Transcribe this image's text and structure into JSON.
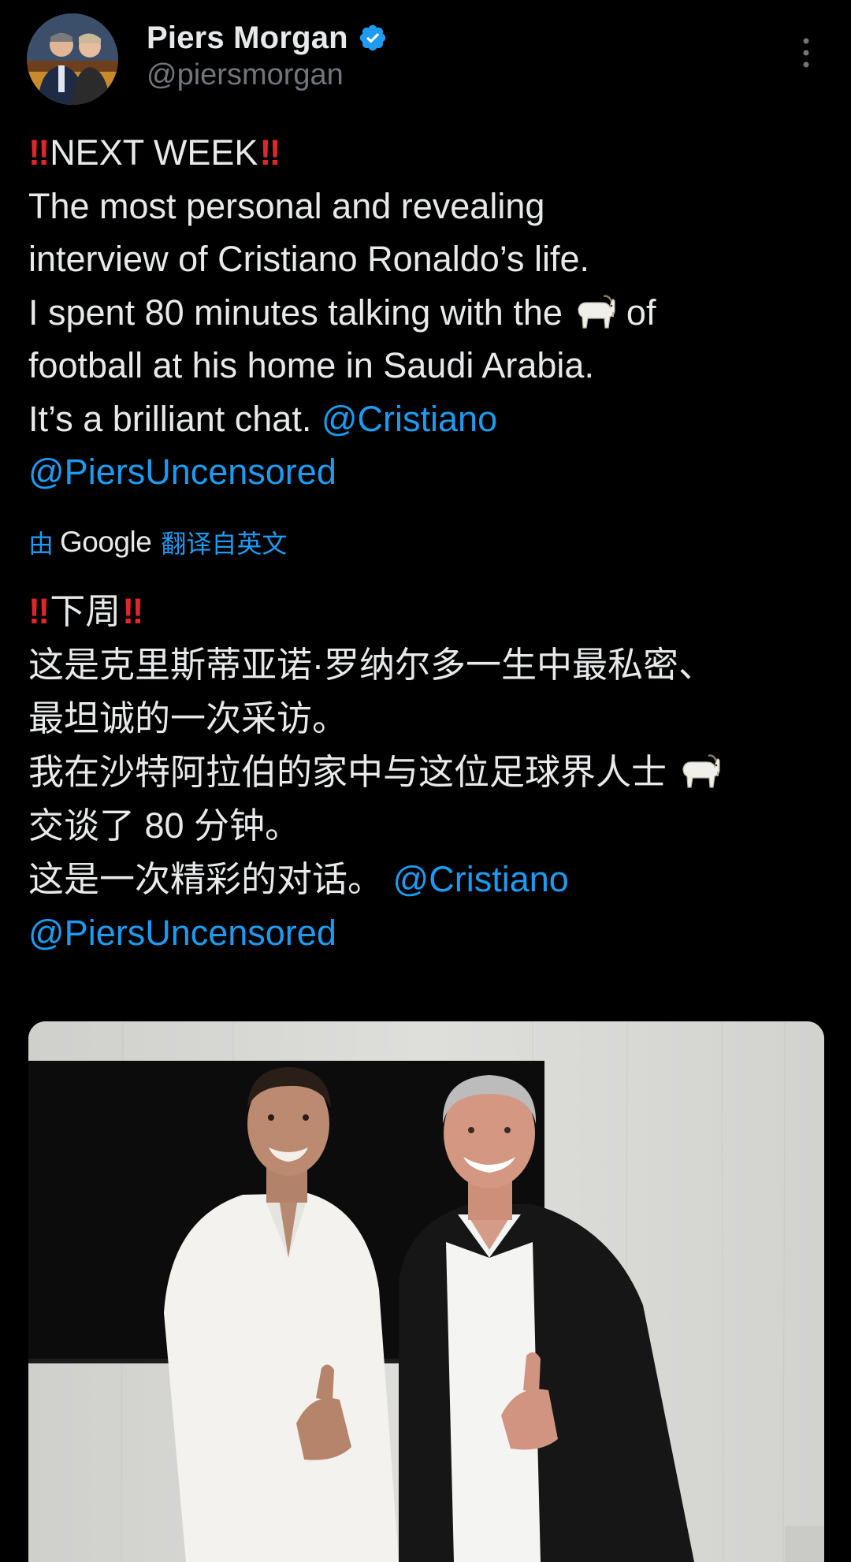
{
  "post": {
    "author": {
      "display_name": "Piers Morgan",
      "handle": "@piersmorgan",
      "verified": true,
      "verified_icon": "verified-badge-icon"
    },
    "more_icon": "more-vertical-icon",
    "text": {
      "line1_label": "NEXT WEEK",
      "line2": "The most personal and revealing",
      "line3": "interview of Cristiano Ronaldo’s life.",
      "line4_before": "I spent 80 minutes talking  with the",
      "line4_after": "of",
      "line5": "football at his home in Saudi Arabia.",
      "line6_before": "It’s a brilliant chat.",
      "mention1": "@Cristiano",
      "mention2": "@PiersUncensored"
    },
    "translation": {
      "prefix": "由",
      "provider": "Google",
      "suffix": "翻译自英文"
    },
    "translated": {
      "line1_label": "下周",
      "line2": "这是克里斯蒂亚诺·罗纳尔多一生中最私密、",
      "line3": "最坦诚的一次采访。",
      "line4": "我在沙特阿拉伯的家中与这位足球界人士",
      "line5": "交谈了 80 分钟。",
      "line6_before": "这是一次精彩的对话。",
      "mention1": "@Cristiano",
      "mention2": "@PiersUncensored"
    },
    "emoji": {
      "double_exclamation": "‼",
      "goat": "goat-icon"
    },
    "media": {
      "type": "photo",
      "icon": "photo-two-men-thumbs-up"
    }
  },
  "colors": {
    "background": "#000000",
    "text": "#e7e9ea",
    "secondary": "#71767b",
    "link": "#1d9bf0",
    "verified": "#1d9bf0",
    "emoji_red": "#e0262b"
  }
}
